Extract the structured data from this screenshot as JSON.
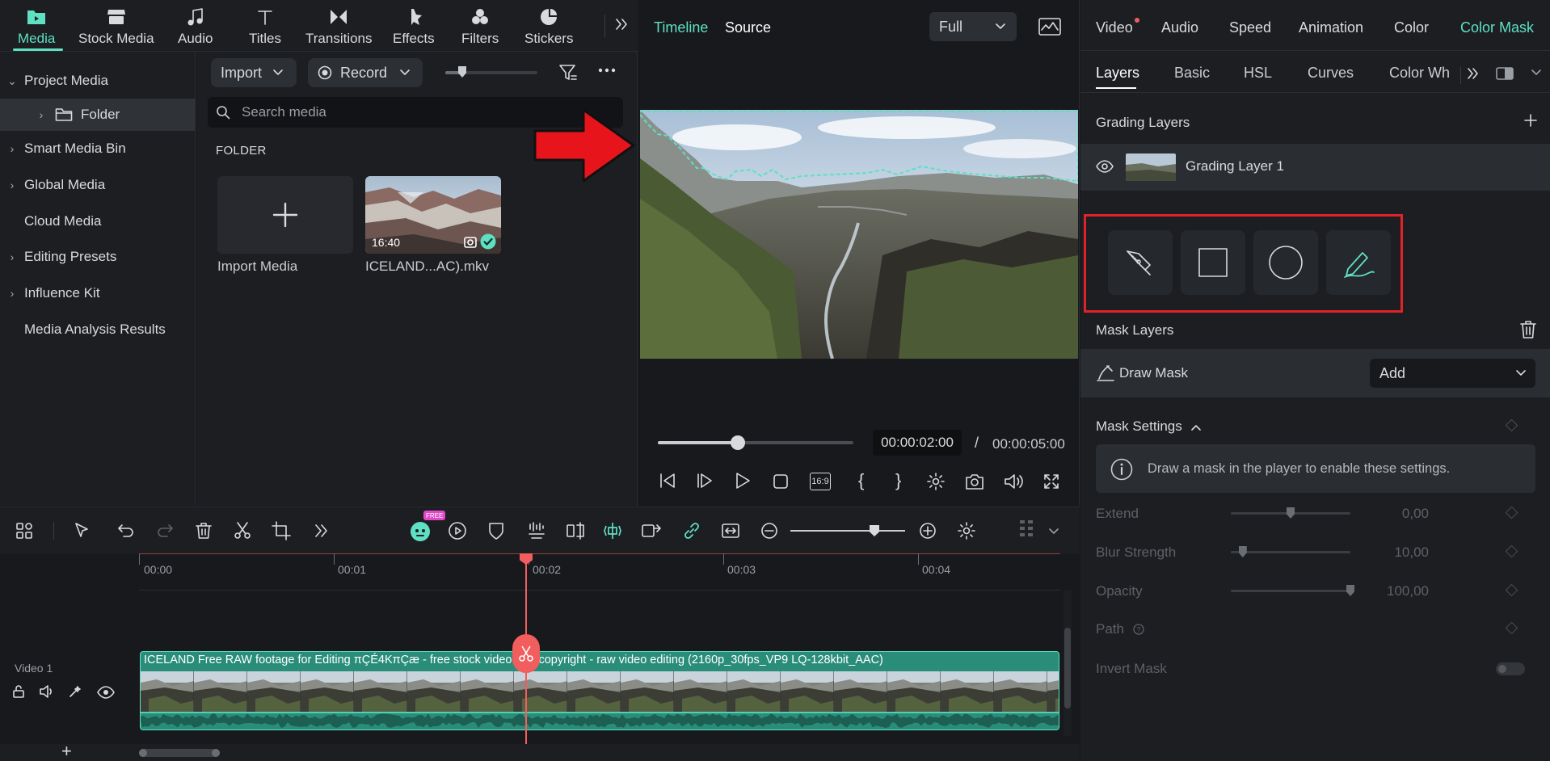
{
  "media_tabs": [
    {
      "label": "Media",
      "icon": "media-folder-icon"
    },
    {
      "label": "Stock Media",
      "icon": "stock-media-icon"
    },
    {
      "label": "Audio",
      "icon": "music-note-icon"
    },
    {
      "label": "Titles",
      "icon": "text-t-icon"
    },
    {
      "label": "Transitions",
      "icon": "transitions-icon"
    },
    {
      "label": "Effects",
      "icon": "effects-icon"
    },
    {
      "label": "Filters",
      "icon": "filters-icon"
    },
    {
      "label": "Stickers",
      "icon": "stickers-icon"
    }
  ],
  "left_nav": {
    "items": [
      {
        "label": "Project Media",
        "chevron": "⌄"
      },
      {
        "label": "Folder",
        "chevron": "›"
      },
      {
        "label": "Smart Media Bin",
        "chevron": "›"
      },
      {
        "label": "Global Media",
        "chevron": "›"
      },
      {
        "label": "Cloud Media",
        "chevron": ""
      },
      {
        "label": "Editing Presets",
        "chevron": "›"
      },
      {
        "label": "Influence Kit",
        "chevron": "›"
      },
      {
        "label": "Media Analysis Results",
        "chevron": ""
      }
    ]
  },
  "media_browser": {
    "import_label": "Import",
    "record_label": "Record",
    "search_placeholder": "Search media",
    "section_title": "FOLDER",
    "import_media_label": "Import Media",
    "clip_name": "ICELAND...AC).mkv",
    "clip_duration": "16:40"
  },
  "preview": {
    "tab_timeline": "Timeline",
    "tab_source": "Source",
    "zoom_value": "Full",
    "current_time": "00:00:02:00",
    "separator": "/",
    "total_time": "00:00:05:00",
    "aspect_label": "16:9",
    "progress": 0.41
  },
  "right_panel": {
    "tabs": [
      {
        "label": "Video",
        "has_dot": true
      },
      {
        "label": "Audio"
      },
      {
        "label": "Speed"
      },
      {
        "label": "Animation"
      },
      {
        "label": "Color"
      },
      {
        "label": "Color Mask"
      }
    ],
    "subtabs": [
      "Layers",
      "Basic",
      "HSL",
      "Curves",
      "Color Wh"
    ],
    "grading_layers_title": "Grading Layers",
    "grading_layer_name": "Grading Layer 1",
    "mask_layers_title": "Mask Layers",
    "draw_mask_label": "Draw Mask",
    "add_label": "Add",
    "mask_settings_title": "Mask Settings",
    "info_text": "Draw a mask in the player to enable these settings.",
    "settings": [
      {
        "label": "Extend",
        "value": "0,00",
        "level": 0.5
      },
      {
        "label": "Blur Strength",
        "value": "10,00",
        "level": 0.1
      },
      {
        "label": "Opacity",
        "value": "100,00",
        "level": 1.0
      },
      {
        "label": "Path"
      },
      {
        "label": "Invert Mask"
      }
    ]
  },
  "timeline": {
    "ticks": [
      "00:00",
      "00:01",
      "00:02",
      "00:03",
      "00:04"
    ],
    "track_name": "Video 1",
    "clip_title": "ICELAND Free RAW footage for Editing πÇÉ4KπÇæ  - free stock video - no copyright - raw video editing (2160p_30fps_VP9 LQ-128kbit_AAC)",
    "free_badge": "FREE"
  },
  "colors": {
    "accent": "#5ee0c3",
    "playhead": "#f25d5d",
    "highlight_box": "#e0232a",
    "arrow": "#e8141c"
  }
}
